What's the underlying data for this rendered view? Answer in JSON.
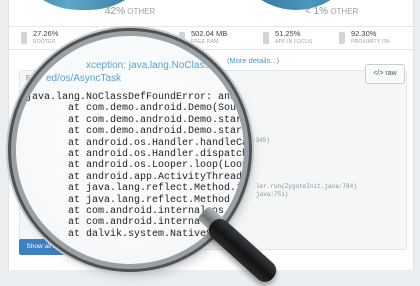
{
  "pies": {
    "left": {
      "percent": "42%",
      "label": "OTHER"
    },
    "right": {
      "percent": "< 1%",
      "label": "OTHER"
    }
  },
  "stats": [
    {
      "value": "27.26%",
      "label": "ROOTED"
    },
    {
      "value": "502.04 MB",
      "label": "FREE RAM"
    },
    {
      "value": "51.25%",
      "label": "APP IN FOCUS"
    },
    {
      "value": "92.30%",
      "label": "PROXIMITY ON"
    }
  ],
  "details_link": "(More details...)",
  "crash": {
    "fatal_label": "Fatal",
    "exception_title": "xception: java.lang.NoClassDefFoundEr",
    "thread_title": "ed/os/AsyncTask",
    "raw_button": "</> raw",
    "threads_button": "Show all 24 Threads",
    "trace_lines": [
      "java.lang.NoClassDefFoundError: android",
      "at com.demo.android.Demo(SourceFi",
      "at com.demo.android.Demo.startAPIK",
      "at com.demo.android.Demo.startAPIK",
      "at android.os.Handler.handleCallba",
      "at android.os.Handler.dispatchMessa",
      "at android.os.Looper.loop(Looper.ja",
      "at android.app.ActivityThread.main",
      "at java.lang.reflect.Method.invoke",
      "at java.lang.reflect.Method.invoke",
      "at com.android.internal.os.Zygot",
      "at com.android.internal.os.Zygo",
      "at dalvik.system.NativeStart.m"
    ],
    "trace_fragments": [
      ":345)",
      "ler.run(ZygoteInit.java:784)",
      "java:751)"
    ]
  }
}
